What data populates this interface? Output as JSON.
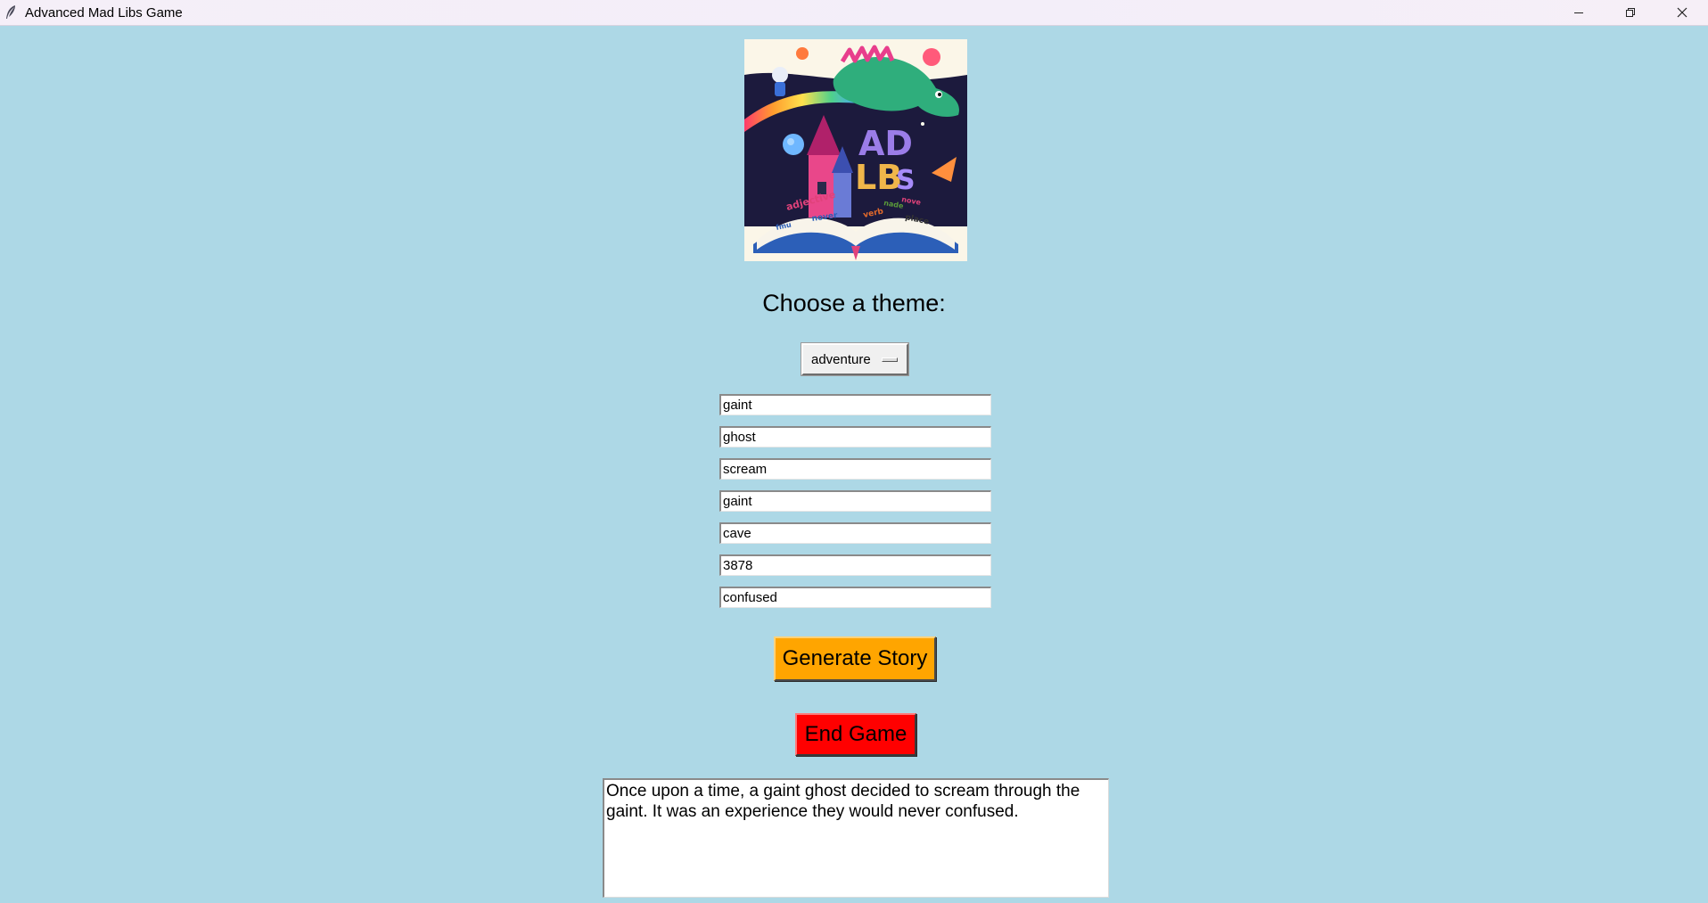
{
  "window": {
    "title": "Advanced Mad Libs Game",
    "app_icon": "feather-icon",
    "controls": [
      "minimize-icon",
      "restore-icon",
      "close-icon"
    ]
  },
  "logo": {
    "name": "mad-libs-logo-image",
    "book_words": [
      "adjective",
      "nover",
      "fmu",
      "verb",
      "nade",
      "nove",
      "place"
    ]
  },
  "theme": {
    "label": "Choose a theme:",
    "selected": "adventure"
  },
  "entries": [
    {
      "value": "gaint"
    },
    {
      "value": "ghost"
    },
    {
      "value": "scream"
    },
    {
      "value": "gaint"
    },
    {
      "value": "cave"
    },
    {
      "value": "3878"
    },
    {
      "value": "confused"
    }
  ],
  "buttons": {
    "generate": "Generate Story",
    "end": "End Game"
  },
  "story": {
    "text": "Once upon a time, a gaint ghost decided to scream through the gaint. It was an experience they would never confused."
  },
  "colors": {
    "background": "#add8e6",
    "generate_button": "#ffa500",
    "end_button": "#ff0000"
  }
}
